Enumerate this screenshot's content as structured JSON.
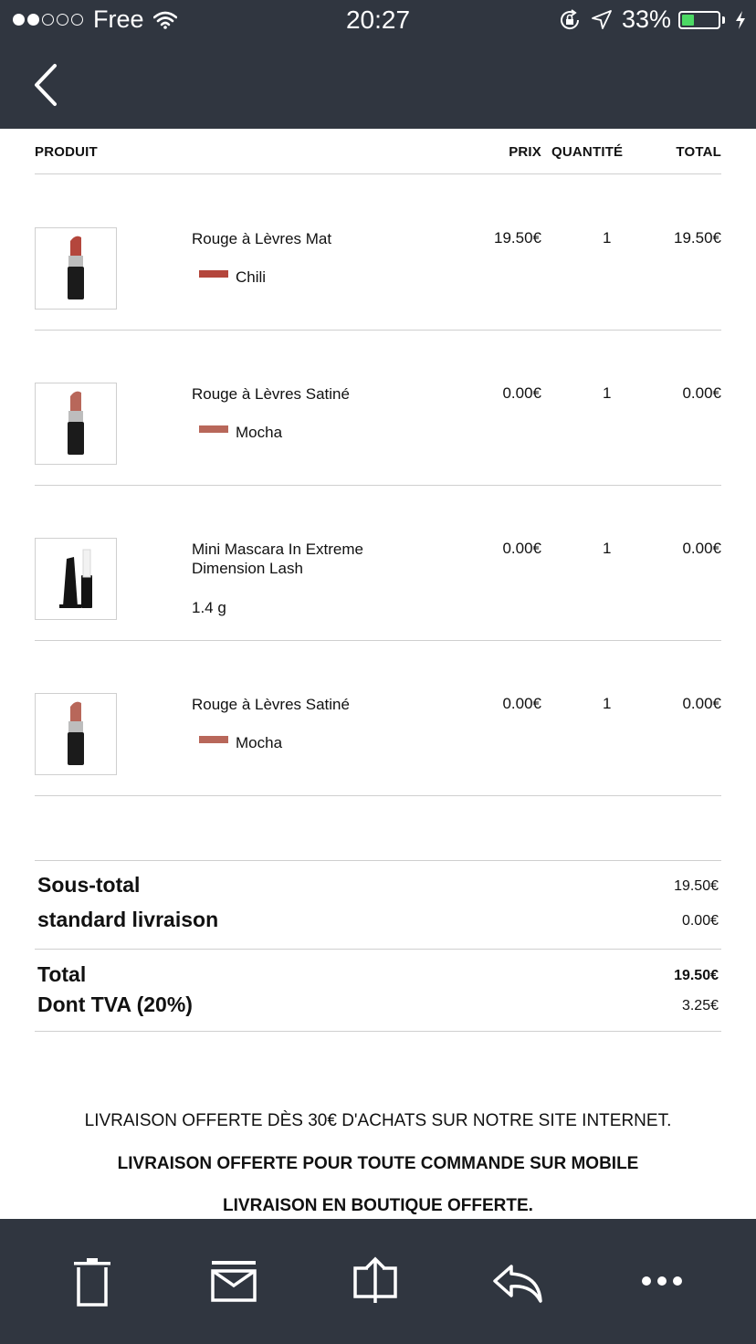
{
  "status_bar": {
    "carrier": "Free",
    "time": "20:27",
    "battery_percent": "33%",
    "battery_level": 0.33,
    "signal_bars_filled": 2,
    "signal_bars_total": 5
  },
  "nav": {
    "back_icon": "chevron-left-icon"
  },
  "table": {
    "headers": {
      "product": "PRODUIT",
      "price": "PRIX",
      "quantity": "QUANTITÉ",
      "total": "TOTAL"
    },
    "rows": [
      {
        "name": "Rouge à Lèvres Mat",
        "variant": "Chili",
        "swatch": "#b4463c",
        "price": "19.50€",
        "quantity": "1",
        "total": "19.50€",
        "image": "lipstick-image"
      },
      {
        "name": "Rouge à Lèvres Satiné",
        "variant": "Mocha",
        "swatch": "#b8675a",
        "price": "0.00€",
        "quantity": "1",
        "total": "0.00€",
        "image": "lipstick-image"
      },
      {
        "name": "Mini Mascara In Extreme Dimension Lash",
        "size": "1.4 g",
        "price": "0.00€",
        "quantity": "1",
        "total": "0.00€",
        "image": "mascara-image"
      },
      {
        "name": "Rouge à Lèvres Satiné",
        "variant": "Mocha",
        "swatch": "#b8675a",
        "price": "0.00€",
        "quantity": "1",
        "total": "0.00€",
        "image": "lipstick-image"
      }
    ]
  },
  "summary": {
    "subtotal_label": "Sous-total",
    "subtotal_value": "19.50€",
    "shipping_label": "standard livraison",
    "shipping_value": "0.00€",
    "total_label": "Total",
    "total_value": "19.50€",
    "vat_label": "Dont TVA (20%)",
    "vat_value": "3.25€"
  },
  "promo": {
    "line1": "LIVRAISON OFFERTE DÈS 30€ D'ACHATS SUR NOTRE SITE INTERNET.",
    "line2": "LIVRAISON OFFERTE POUR TOUTE COMMANDE SUR MOBILE",
    "line3": "LIVRAISON EN BOUTIQUE OFFERTE."
  },
  "toolbar": {
    "icons": [
      "trash-icon",
      "archive-icon",
      "move-to-folder-icon",
      "reply-icon",
      "more-icon"
    ]
  },
  "colors": {
    "bar_bg": "#303640",
    "battery_green": "#4cd964",
    "divider": "#cfcfcf"
  }
}
